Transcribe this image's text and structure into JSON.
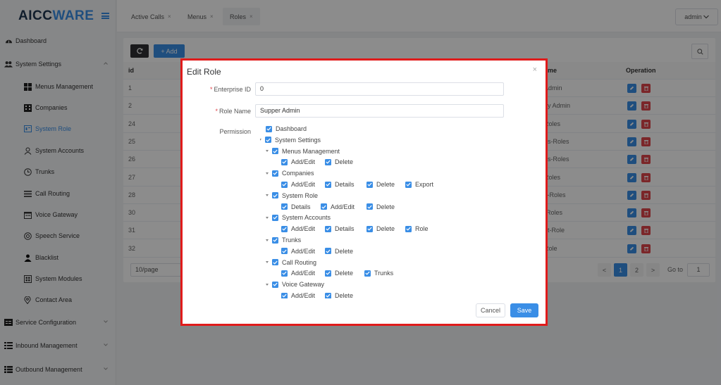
{
  "app": {
    "logo_main": "AICC",
    "logo_accent": "WARE"
  },
  "sidebar": {
    "items": [
      {
        "label": "Dashboard"
      },
      {
        "label": "System Settings"
      },
      {
        "label": "Menus Management"
      },
      {
        "label": "Companies"
      },
      {
        "label": "System Role"
      },
      {
        "label": "System Accounts"
      },
      {
        "label": "Trunks"
      },
      {
        "label": "Call Routing"
      },
      {
        "label": "Voice Gateway"
      },
      {
        "label": "Speech Service"
      },
      {
        "label": "Blacklist"
      },
      {
        "label": "System Modules"
      },
      {
        "label": "Contact Area"
      },
      {
        "label": "Service Configuration"
      },
      {
        "label": "Inbound Management"
      },
      {
        "label": "Outbound Management"
      }
    ]
  },
  "tabs": [
    {
      "label": "Active Calls",
      "close": "×"
    },
    {
      "label": "Menus",
      "close": "×"
    },
    {
      "label": "Roles",
      "close": "×"
    }
  ],
  "user": {
    "name": "admin"
  },
  "toolbar": {
    "add_label": "+ Add"
  },
  "table": {
    "col_id": "id",
    "col_name": "ame",
    "col_op": "Operation",
    "rows": [
      {
        "id": "1",
        "name": "Admin"
      },
      {
        "id": "2",
        "name": "ny Admin"
      },
      {
        "id": "24",
        "name": "Roles"
      },
      {
        "id": "25",
        "name": "ds-Roles"
      },
      {
        "id": "26",
        "name": "ds-Roles"
      },
      {
        "id": "27",
        "name": "Roles"
      },
      {
        "id": "28",
        "name": "c-Roles"
      },
      {
        "id": "30",
        "name": "-Roles"
      },
      {
        "id": "31",
        "name": "nt-Role"
      },
      {
        "id": "32",
        "name": "Role"
      }
    ]
  },
  "pagination": {
    "page_size": "10/page",
    "prev": "<",
    "pages": [
      "1",
      "2"
    ],
    "next": ">",
    "goto_label": "Go to",
    "goto_value": "1"
  },
  "modal": {
    "title": "Edit Role",
    "close": "×",
    "enterprise_label": "Enterprise ID",
    "enterprise_value": "0",
    "role_label": "Role Name",
    "role_value": "Supper Admin",
    "required_mark": "*",
    "permission_label": "Permission",
    "tree": [
      {
        "label": "Dashboard"
      },
      {
        "label": "System Settings"
      },
      {
        "label": "Menus Management"
      },
      {
        "label": "Add/Edit"
      },
      {
        "label": "Delete"
      },
      {
        "label": "Companies"
      },
      {
        "label": "Add/Edit"
      },
      {
        "label": "Details"
      },
      {
        "label": "Delete"
      },
      {
        "label": "Export"
      },
      {
        "label": "System Role"
      },
      {
        "label": "Details"
      },
      {
        "label": "Add/Edit"
      },
      {
        "label": "Delete"
      },
      {
        "label": "System Accounts"
      },
      {
        "label": "Add/Edit"
      },
      {
        "label": "Details"
      },
      {
        "label": "Delete"
      },
      {
        "label": "Role"
      },
      {
        "label": "Trunks"
      },
      {
        "label": "Add/Edit"
      },
      {
        "label": "Delete"
      },
      {
        "label": "Call Routing"
      },
      {
        "label": "Add/Edit"
      },
      {
        "label": "Delete"
      },
      {
        "label": "Trunks"
      },
      {
        "label": "Voice Gateway"
      },
      {
        "label": "Add/Edit"
      },
      {
        "label": "Delete"
      }
    ],
    "cancel_label": "Cancel",
    "save_label": "Save"
  },
  "colors": {
    "accent": "#3a8ee6",
    "danger": "#e0454b",
    "highlight_frame": "#e01b1b"
  }
}
